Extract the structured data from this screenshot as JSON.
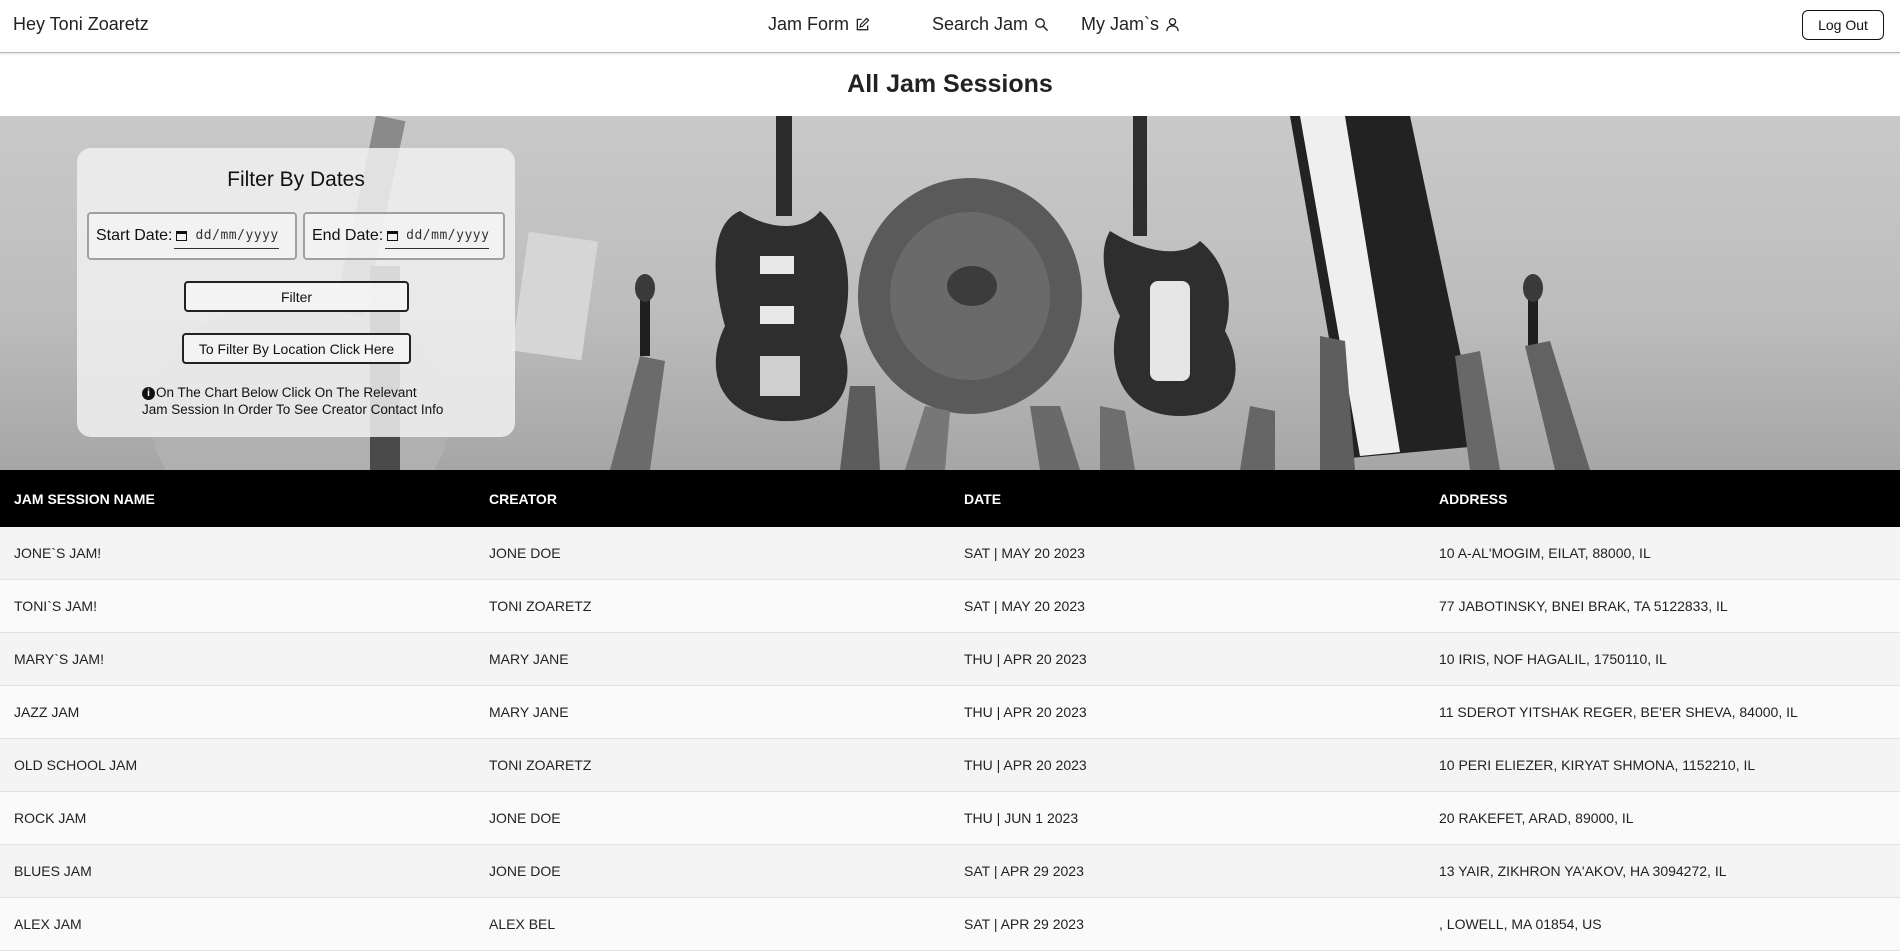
{
  "navbar": {
    "greeting": "Hey Toni Zoaretz",
    "links": [
      {
        "label": "Jam Form",
        "icon": "edit-icon"
      },
      {
        "label": "Search Jam",
        "icon": "search-icon"
      },
      {
        "label": "My Jam`s",
        "icon": "user-icon"
      }
    ],
    "logout_label": "Log Out"
  },
  "page_title": "All Jam Sessions",
  "filter": {
    "title": "Filter By Dates",
    "start_label": "Start Date:",
    "end_label": "End Date:",
    "date_placeholder": "dd/mm/yyyy",
    "filter_button": "Filter",
    "location_button": "To Filter By Location Click Here",
    "info_line1": "On The Chart Below Click On The Relevant",
    "info_line2": "Jam Session In Order To See Creator Contact Info"
  },
  "table": {
    "headers": [
      "JAM SESSION NAME",
      "CREATOR",
      "DATE",
      "ADDRESS"
    ],
    "rows": [
      [
        "JONE`S JAM!",
        "JONE DOE",
        "SAT | MAY 20 2023",
        "10 A-AL'MOGIM, EILAT, 88000, IL"
      ],
      [
        "TONI`S JAM!",
        "TONI ZOARETZ",
        "SAT | MAY 20 2023",
        "77 JABOTINSKY, BNEI BRAK, TA 5122833, IL"
      ],
      [
        "MARY`S JAM!",
        "MARY JANE",
        "THU | APR 20 2023",
        "10 IRIS, NOF HAGALIL, 1750110, IL"
      ],
      [
        "JAZZ JAM",
        "MARY JANE",
        "THU | APR 20 2023",
        "11 SDEROT YITSHAK REGER, BE'ER SHEVA, 84000, IL"
      ],
      [
        "OLD SCHOOL JAM",
        "TONI ZOARETZ",
        "THU | APR 20 2023",
        "10 PERI ELIEZER, KIRYAT SHMONA, 1152210, IL"
      ],
      [
        "ROCK JAM",
        "JONE DOE",
        "THU | JUN 1 2023",
        "20 RAKEFET, ARAD, 89000, IL"
      ],
      [
        "BLUES JAM",
        "JONE DOE",
        "SAT | APR 29 2023",
        "13 YAIR, ZIKHRON YA'AKOV, HA 3094272, IL"
      ],
      [
        "ALEX JAM",
        "ALEX BEL",
        "SAT | APR 29 2023",
        ", LOWELL, MA 01854, US"
      ]
    ]
  }
}
